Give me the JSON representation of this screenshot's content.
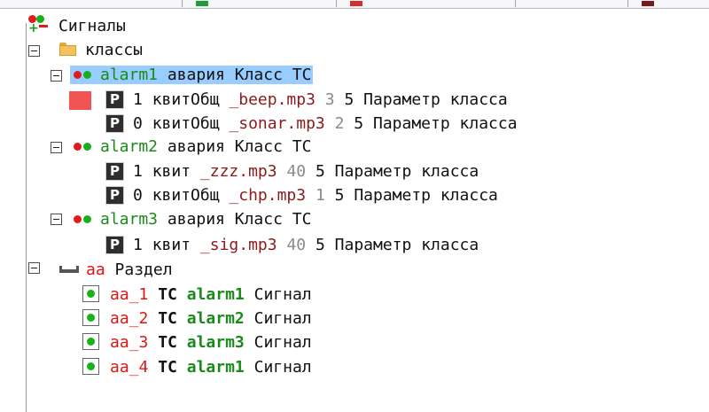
{
  "colors": {
    "selection": "#99ccff",
    "name_green": "#1a8a1a",
    "file_maroon": "#8b1a1a",
    "signal_red": "#e01515",
    "flag_red": "#f25454",
    "tab_green": "#1f9e3a",
    "tab_red": "#d23030",
    "tab_maroon": "#7a1a1a"
  },
  "tree": {
    "root": {
      "icon": "signals-icon",
      "label": "Сигналы"
    },
    "classes": {
      "icon": "folder-icon",
      "label": "классы"
    },
    "alarms": [
      {
        "name": "alarm1",
        "desc": "авария",
        "type": "Класс ТС",
        "selected": true,
        "params": [
          {
            "icon": "param-p-icon",
            "num": "1",
            "ack": "квитОбщ",
            "file": "_beep.mp3",
            "a": "3",
            "b": "5",
            "desc": "Параметр класса",
            "flag": true
          },
          {
            "icon": "param-p-icon",
            "num": "0",
            "ack": "квитОбщ",
            "file": "_sonar.mp3",
            "a": "2",
            "b": "5",
            "desc": "Параметр класса"
          }
        ]
      },
      {
        "name": "alarm2",
        "desc": "авария",
        "type": "Класс ТС",
        "params": [
          {
            "icon": "param-p-icon",
            "num": "1",
            "ack": "квит",
            "file": "_zzz.mp3",
            "a": "40",
            "b": "5",
            "desc": "Параметр класса"
          },
          {
            "icon": "param-p-icon",
            "num": "0",
            "ack": "квитОбщ",
            "file": "_chp.mp3",
            "a": "1",
            "b": "5",
            "desc": "Параметр класса"
          }
        ]
      },
      {
        "name": "alarm3",
        "desc": "авария",
        "type": "Класс ТС",
        "params": [
          {
            "icon": "param-p-icon",
            "num": "1",
            "ack": "квит",
            "file": "_sig.mp3",
            "a": "40",
            "b": "5",
            "desc": "Параметр класса"
          }
        ]
      }
    ],
    "section": {
      "icon": "section-icon",
      "name": "аа",
      "label": "Раздел",
      "signals": [
        {
          "id": "aa_1",
          "type": "ТС",
          "alarm": "alarm1",
          "label": "Сигнал"
        },
        {
          "id": "aa_2",
          "type": "ТС",
          "alarm": "alarm2",
          "label": "Сигнал"
        },
        {
          "id": "aa_3",
          "type": "ТС",
          "alarm": "alarm3",
          "label": "Сигнал"
        },
        {
          "id": "aa_4",
          "type": "ТС",
          "alarm": "alarm1",
          "label": "Сигнал"
        }
      ]
    }
  }
}
